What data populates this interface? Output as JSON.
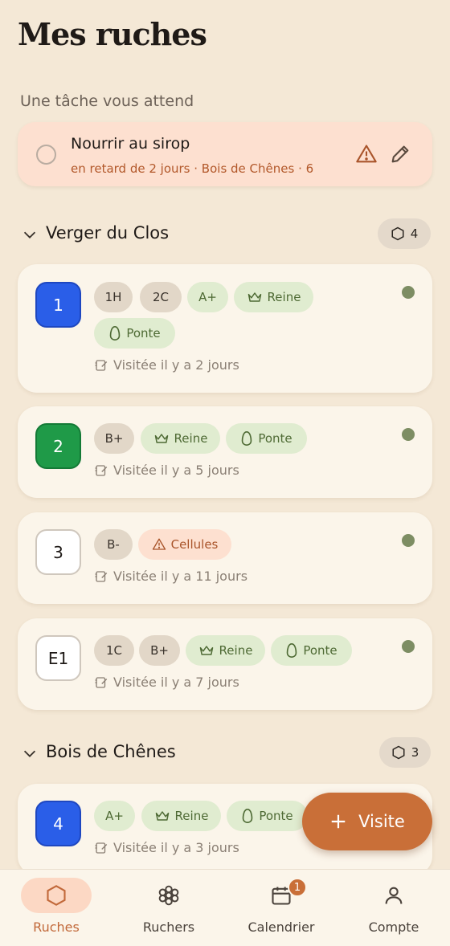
{
  "header": {
    "title": "Mes ruches"
  },
  "task_section": {
    "label": "Une tâche vous attend"
  },
  "task": {
    "title": "Nourrir au sirop",
    "subtitle": "en retard de 2 jours · Bois de Chênes · 6"
  },
  "sections": [
    {
      "name": "Verger du Clos",
      "count": "4",
      "hives": [
        {
          "id": "1",
          "color": "#2a5ee8",
          "chips": [
            "1H",
            "2C",
            "A+",
            "Reine",
            "Ponte"
          ],
          "visited": "Visitée il y a 2 jours"
        },
        {
          "id": "2",
          "color": "#1f9a48",
          "chips": [
            "B+",
            "Reine",
            "Ponte"
          ],
          "visited": "Visitée il y a 5 jours"
        },
        {
          "id": "3",
          "color": "#ffffff",
          "chips": [
            "B-",
            "Cellules"
          ],
          "visited": "Visitée il y a 11 jours"
        },
        {
          "id": "E1",
          "color": "#ffffff",
          "chips": [
            "1C",
            "B+",
            "Reine",
            "Ponte"
          ],
          "visited": "Visitée il y a 7 jours"
        }
      ]
    },
    {
      "name": "Bois de Chênes",
      "count": "3",
      "hives": [
        {
          "id": "4",
          "color": "#2a5ee8",
          "chips": [
            "A+",
            "Reine",
            "Ponte"
          ],
          "visited": "Visitée il y a 3 jours"
        }
      ]
    }
  ],
  "fab": {
    "label": "Visite"
  },
  "nav": {
    "items": [
      {
        "label": "Ruches",
        "icon": "hexagon-icon",
        "active": true
      },
      {
        "label": "Ruchers",
        "icon": "flower-icon"
      },
      {
        "label": "Calendrier",
        "icon": "calendar-icon",
        "badge": "1"
      },
      {
        "label": "Compte",
        "icon": "user-icon"
      }
    ]
  },
  "colors": {
    "accent": "#c96f38",
    "status_ok": "#7d8d63",
    "background": "#f4e8d6"
  }
}
